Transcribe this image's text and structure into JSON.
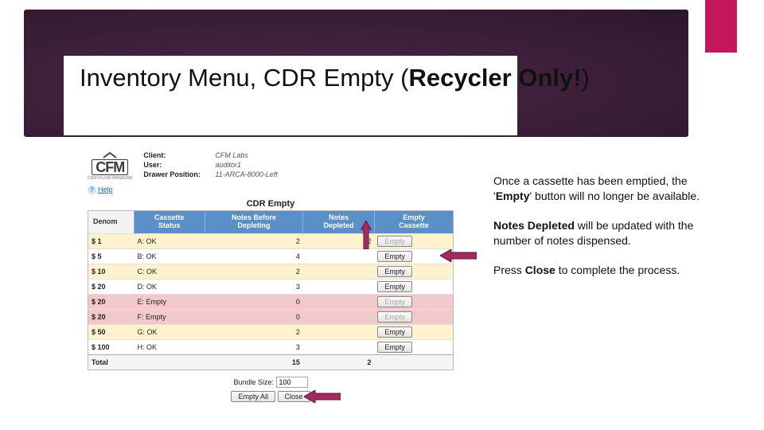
{
  "slide": {
    "title_plain": "Inventory Menu, CDR Empty (",
    "title_bold": "Recycler Only!",
    "title_tail": ")"
  },
  "logo": {
    "name": "CFM",
    "sub": "CASH FLOW MANAGER"
  },
  "client_info": {
    "client_label": "Client:",
    "client_value": "CFM Labs",
    "user_label": "User:",
    "user_value": "auditor1",
    "drawer_label": "Drawer Position:",
    "drawer_value": "11-ARCA-8000-Left"
  },
  "help": {
    "label": "Help"
  },
  "panel_title": "CDR Empty",
  "columns": {
    "denom": "Denom",
    "cassette_status_l1": "Cassette",
    "cassette_status_l2": "Status",
    "notes_before_l1": "Notes Before",
    "notes_before_l2": "Depleting",
    "notes_depleted_l1": "Notes",
    "notes_depleted_l2": "Depleted",
    "empty_cassette_l1": "Empty",
    "empty_cassette_l2": "Cassette"
  },
  "rows": [
    {
      "denom": "$ 1",
      "status": "A: OK",
      "before": "2",
      "depleted": "2",
      "pink": false,
      "disabled": true
    },
    {
      "denom": "$ 5",
      "status": "B: OK",
      "before": "4",
      "depleted": "",
      "pink": false,
      "disabled": false
    },
    {
      "denom": "$ 10",
      "status": "C: OK",
      "before": "2",
      "depleted": "",
      "pink": false,
      "disabled": false
    },
    {
      "denom": "$ 20",
      "status": "D: OK",
      "before": "3",
      "depleted": "",
      "pink": false,
      "disabled": false
    },
    {
      "denom": "$ 20",
      "status": "E: Empty",
      "before": "0",
      "depleted": "",
      "pink": true,
      "disabled": true
    },
    {
      "denom": "$ 20",
      "status": "F: Empty",
      "before": "0",
      "depleted": "",
      "pink": true,
      "disabled": true
    },
    {
      "denom": "$ 50",
      "status": "G: OK",
      "before": "2",
      "depleted": "",
      "pink": false,
      "disabled": false
    },
    {
      "denom": "$ 100",
      "status": "H: OK",
      "before": "3",
      "depleted": "",
      "pink": false,
      "disabled": false
    }
  ],
  "totals": {
    "label": "Total",
    "before": "15",
    "depleted": "2"
  },
  "footer": {
    "bundle_label": "Bundle Size:",
    "bundle_value": "100",
    "empty_all": "Empty All",
    "close": "Close"
  },
  "row_button_label": "Empty",
  "sidebar": {
    "p1a": "Once a cassette has been emptied, the '",
    "p1b": "Empty",
    "p1c": "' button will no longer be available.",
    "p2a": "Notes Depleted",
    "p2b": " will be updated with the number of notes dispensed.",
    "p3a": "Press ",
    "p3b": "Close",
    "p3c": " to complete the process."
  },
  "colors": {
    "accent": "#c2185b",
    "arrow_fill": "#a12b5c",
    "arrow_stroke": "#5a1236"
  }
}
